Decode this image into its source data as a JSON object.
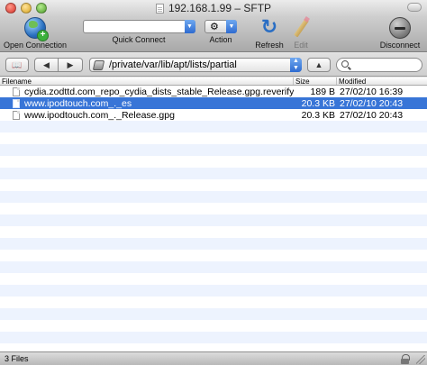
{
  "window": {
    "title": "192.168.1.99 – SFTP"
  },
  "toolbar": {
    "open_connection_label": "Open Connection",
    "quick_connect_label": "Quick Connect",
    "quick_connect_value": "",
    "action_label": "Action",
    "action_icon": "gear-icon",
    "refresh_label": "Refresh",
    "edit_label": "Edit",
    "disconnect_label": "Disconnect"
  },
  "navigation": {
    "path": "/private/var/lib/apt/lists/partial",
    "search_value": ""
  },
  "table": {
    "columns": [
      "Filename",
      "Size",
      "Modified"
    ],
    "rows": [
      {
        "name": "cydia.zodttd.com_repo_cydia_dists_stable_Release.gpg.reverify",
        "size": "189 B",
        "modified": "27/02/10 16:39",
        "selected": false
      },
      {
        "name": "www.ipodtouch.com_._es",
        "size": "20.3 KB",
        "modified": "27/02/10 20:43",
        "selected": true
      },
      {
        "name": "www.ipodtouch.com_._Release.gpg",
        "size": "20.3 KB",
        "modified": "27/02/10 20:43",
        "selected": false
      }
    ]
  },
  "status": {
    "text": "3 Files"
  },
  "colors": {
    "selection": "#3875d7",
    "alt_row": "#edf3fe",
    "accent_blue": "#2e6bd0"
  }
}
